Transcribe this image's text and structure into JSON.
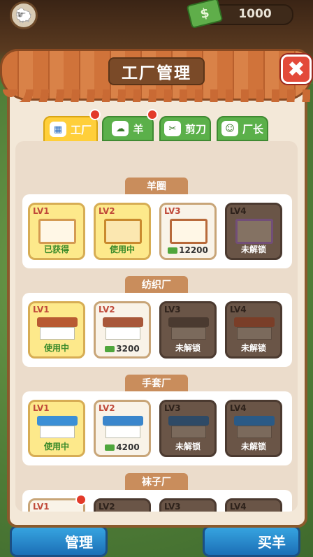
{
  "top_bar": {
    "money": "1000"
  },
  "panel": {
    "title": "工厂管理",
    "close": "✖"
  },
  "tabs": [
    {
      "label": "工厂",
      "active": true,
      "badge": true
    },
    {
      "label": "羊",
      "active": false,
      "badge": true
    },
    {
      "label": "剪刀",
      "active": false,
      "badge": false
    },
    {
      "label": "厂长",
      "active": false,
      "badge": false
    }
  ],
  "sections": [
    {
      "title": "羊圈",
      "cards": [
        {
          "level": "LV1",
          "status": "已获得",
          "style": "yellow"
        },
        {
          "level": "LV2",
          "status": "使用中",
          "style": "yellow"
        },
        {
          "level": "LV3",
          "status": "12200",
          "style": "white"
        },
        {
          "level": "LV4",
          "status": "未解锁",
          "style": "dark"
        }
      ]
    },
    {
      "title": "纺织厂",
      "cards": [
        {
          "level": "LV1",
          "status": "使用中",
          "style": "yellow"
        },
        {
          "level": "LV2",
          "status": "3200",
          "style": "white"
        },
        {
          "level": "LV3",
          "status": "未解锁",
          "style": "dark"
        },
        {
          "level": "LV4",
          "status": "未解锁",
          "style": "dark"
        }
      ]
    },
    {
      "title": "手套厂",
      "cards": [
        {
          "level": "LV1",
          "status": "使用中",
          "style": "yellow"
        },
        {
          "level": "LV2",
          "status": "4200",
          "style": "white"
        },
        {
          "level": "LV3",
          "status": "未解锁",
          "style": "dark"
        },
        {
          "level": "LV4",
          "status": "未解锁",
          "style": "dark"
        }
      ]
    },
    {
      "title": "袜子厂",
      "cards": [
        {
          "level": "LV1",
          "status": "",
          "style": "white"
        },
        {
          "level": "LV2",
          "status": "",
          "style": "dark"
        },
        {
          "level": "LV3",
          "status": "",
          "style": "dark"
        },
        {
          "level": "LV4",
          "status": "",
          "style": "dark"
        }
      ]
    }
  ],
  "bottom": {
    "left_label": "管理",
    "right_label": "买羊"
  }
}
